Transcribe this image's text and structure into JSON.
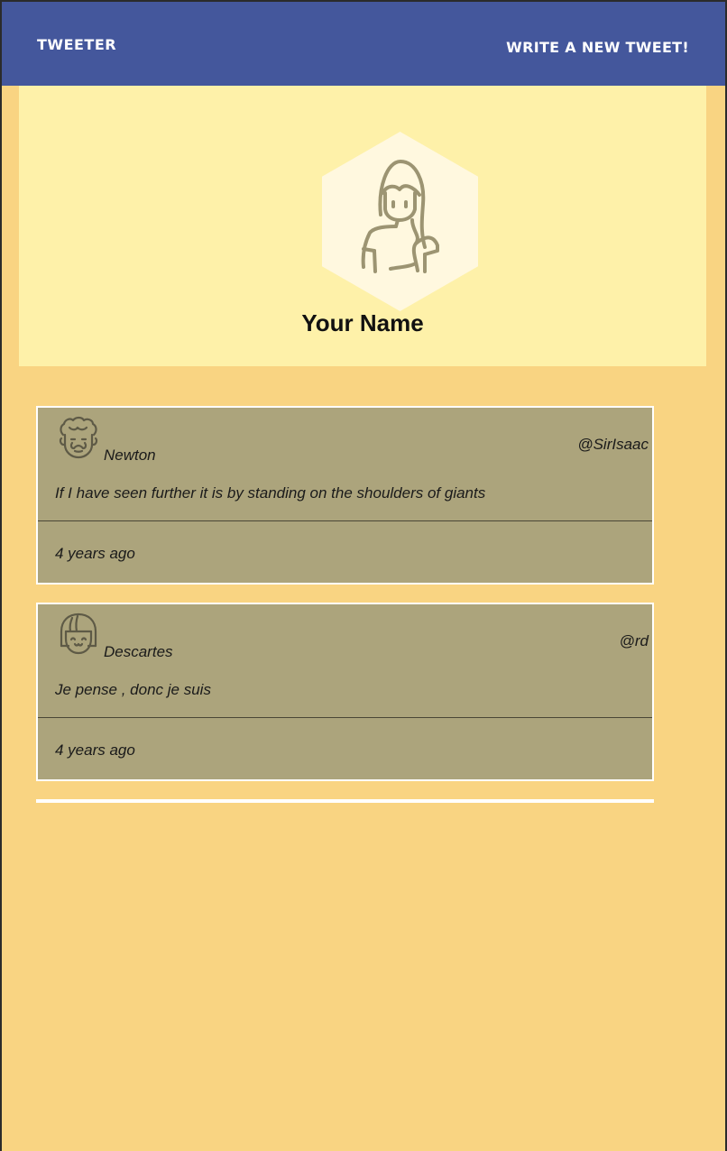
{
  "navbar": {
    "brand": "TWEETER",
    "write_link": "WRITE A NEW TWEET!"
  },
  "profile": {
    "name": "Your Name",
    "avatar_icon": "woman-avatar-icon"
  },
  "tweets": [
    {
      "name": "Newton",
      "handle": "@SirIsaac",
      "text": "If I have seen further it is by standing on the shoulders of giants",
      "time": "4 years ago",
      "avatar_icon": "curly-hair-man-avatar-icon"
    },
    {
      "name": "Descartes",
      "handle": "@rd",
      "text": "Je pense , donc je suis",
      "time": "4 years ago",
      "avatar_icon": "bob-hair-person-avatar-icon"
    }
  ],
  "colors": {
    "navbar": "#44579c",
    "background": "#f9d482",
    "profile_panel": "#fef1a9",
    "tweet_card": "#aca47c"
  }
}
